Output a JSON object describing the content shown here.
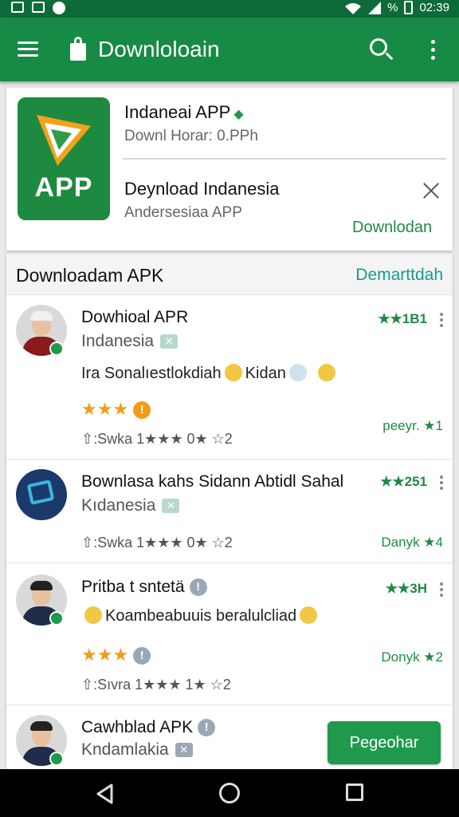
{
  "status_bar": {
    "battery_text": "%",
    "time": "02:39"
  },
  "app_bar": {
    "title": "Downloloain"
  },
  "featured": {
    "app_icon_text": "APP",
    "title": "Indaneai APP",
    "subtitle": "Downl Horar: 0.PPh",
    "name": "Deynload Indanesia",
    "name_sub": "Andersesiaa APP",
    "download_label": "Downlodan"
  },
  "list": {
    "header_title": "Downloadam APK",
    "header_more": "Demarttdah",
    "items": [
      {
        "title": "Dowhioal APR",
        "subtitle": "Indanesia",
        "desc_a": "Ira Sonalıestlokdiah",
        "desc_b": "Kidan",
        "stars": "★★★",
        "meta": "⇧:Swka  1★★★ 0★  ☆2",
        "rating": "★★1B1",
        "count": "peeyr. ★1"
      },
      {
        "title": "Bownlasa kahs Sidann Abtidl Sahal",
        "subtitle": "Kıdanesia",
        "meta": "⇧:Swka  1★★★ 0★  ☆2",
        "rating": "★★251",
        "count": "Danyk ★4"
      },
      {
        "title": "Pritba t sntetä",
        "desc": "Koambeabuuis beralulcliad",
        "stars": "★★★",
        "meta": "⇧:Sıvra  1★★★ 1★  ☆2",
        "rating": "★★3H",
        "count": "Donyk ★2"
      },
      {
        "title": "Cawhblad APK",
        "subtitle": "Kndamlakia",
        "button_label": "Pegeohar"
      }
    ]
  }
}
